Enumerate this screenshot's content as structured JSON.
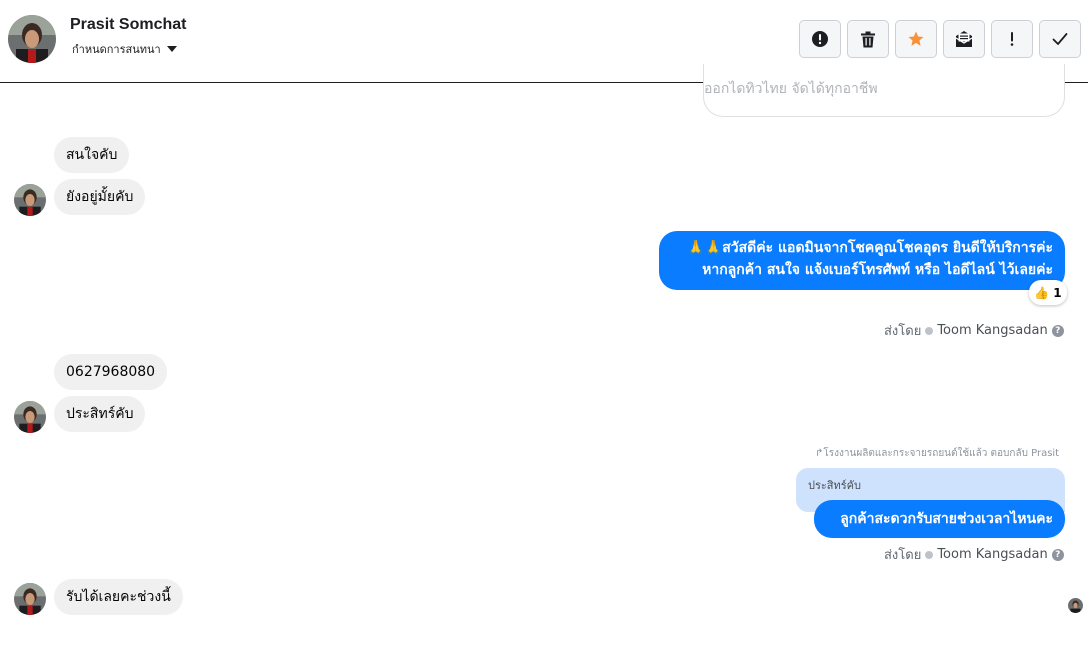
{
  "header": {
    "contact_name": "Prasit Somchat",
    "conversation_settings_label": "กำหนดการสนทนา",
    "actions": [
      {
        "name": "report",
        "icon": "exclamation-circle-icon"
      },
      {
        "name": "delete",
        "icon": "trash-icon"
      },
      {
        "name": "star",
        "icon": "star-icon",
        "color": "#f7923b"
      },
      {
        "name": "mark-unread",
        "icon": "envelope-icon"
      },
      {
        "name": "important",
        "icon": "exclamation-icon"
      },
      {
        "name": "done",
        "icon": "checkmark-icon"
      }
    ]
  },
  "messages": {
    "previous_card_text": "ออกไดทิวไทย จัดได้ทุกอาชีพ",
    "incoming_1": "สนใจคับ",
    "incoming_2": "ยังอยู่มั้ยคับ",
    "outgoing_1_line1": "🙏🙏สวัสดีค่ะ แอดมินจากโชคคูณโชคอุดร ยินดีให้บริการค่ะ",
    "outgoing_1_line2": "หากลูกค้า สนใจ แจ้งเบอร์โทรศัพท์ หรือ ไอดีไลน์  ไว้เลยค่ะ",
    "reaction_emoji": "👍",
    "reaction_count": "1",
    "sent_by_label": "ส่งโดย",
    "agent_name": "Toom Kangsadan",
    "incoming_3": "0627968080",
    "incoming_4": "ประสิทร์คับ",
    "reply_meta": "↱โรงงานผลิตและกระจายรถยนต์ใช้แล้ว ตอบกลับ Prasit",
    "quoted_text": "ประสิทร์คับ",
    "outgoing_2": "ลูกค้าสะดวกรับสายช่วงเวลาไหนคะ",
    "incoming_5": "รับได้เลยคะช่วงนี้"
  },
  "colors": {
    "outgoing_bubble": "#0a7cff",
    "incoming_bubble": "#f0f0f0",
    "quoted_bg": "#cfe2fd"
  }
}
